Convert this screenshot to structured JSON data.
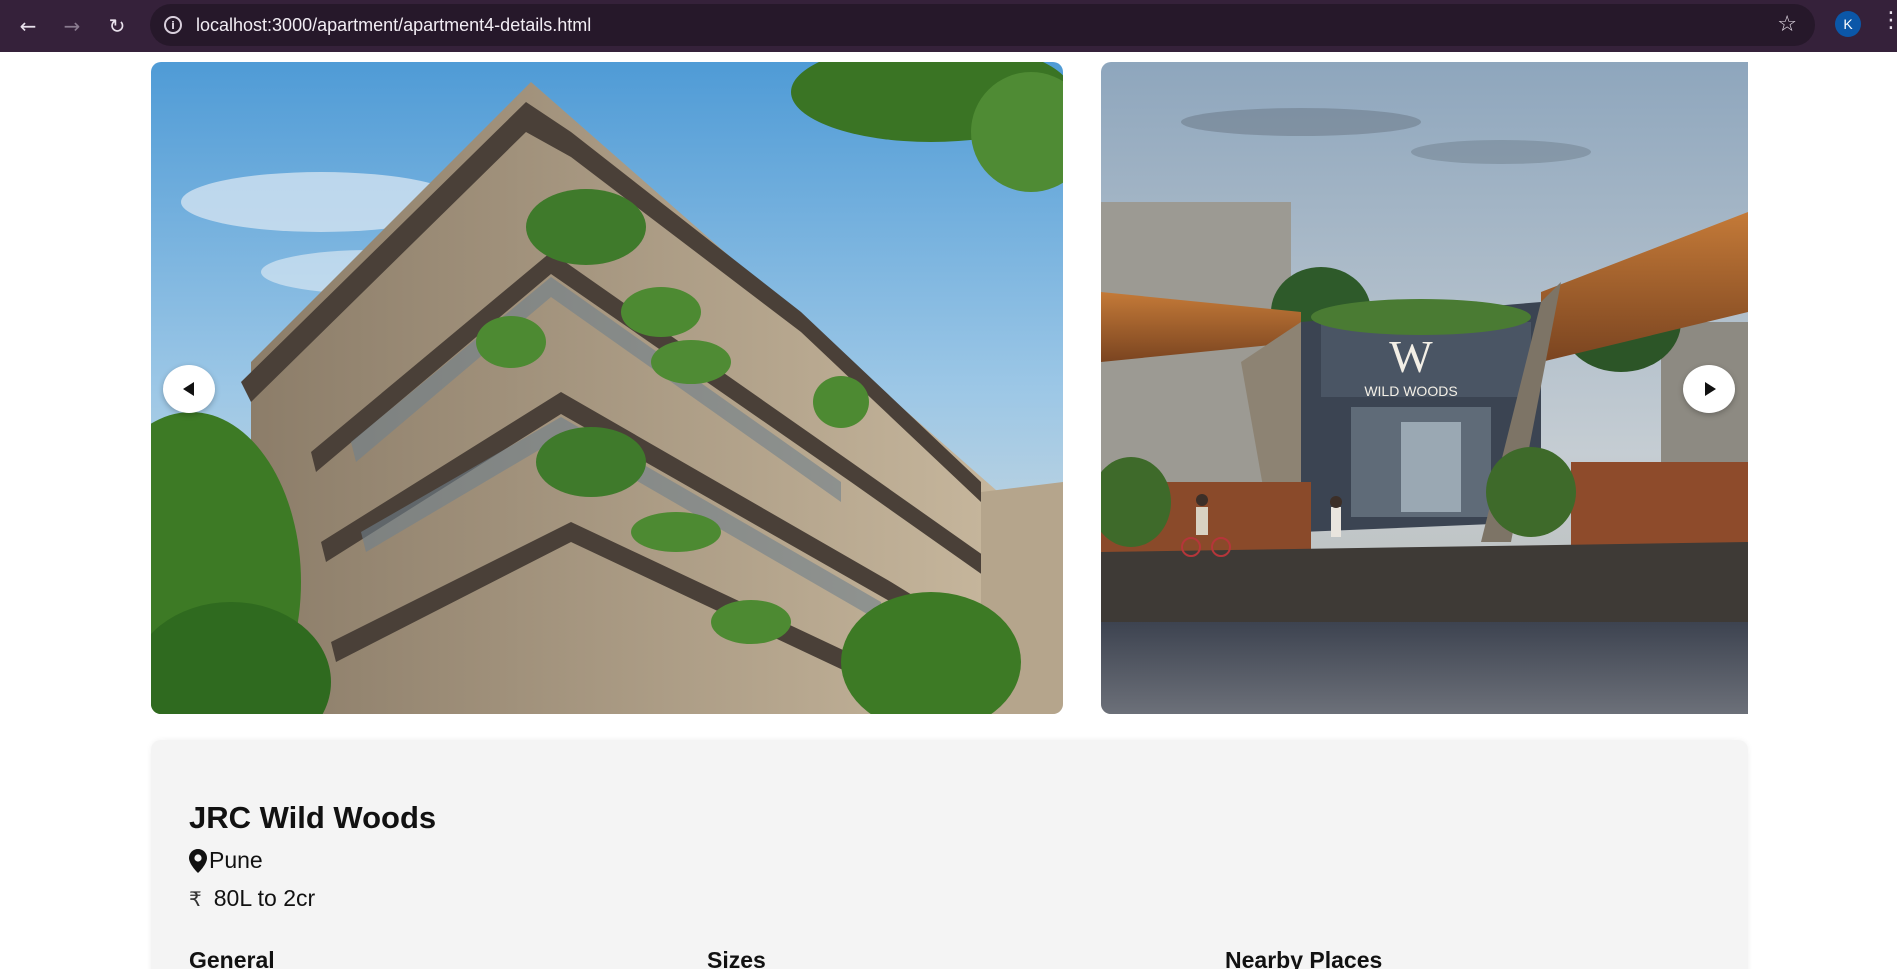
{
  "browser": {
    "url": "localhost:3000/apartment/apartment4-details.html",
    "profile_initial": "K",
    "icons": {
      "back": "back-arrow-icon",
      "forward": "forward-arrow-icon",
      "reload": "reload-icon",
      "info": "site-info-icon",
      "star": "bookmark-star-icon",
      "menu": "kebab-menu-icon"
    },
    "chrome_color": "#35213a"
  },
  "carousel": {
    "slides": [
      {
        "name": "building-facade-image",
        "sign_text": ""
      },
      {
        "name": "wild-woods-entrance-image",
        "sign_letter": "W",
        "sign_text": "WILD WOODS"
      }
    ]
  },
  "property": {
    "title": "JRC Wild Woods",
    "location": "Pune",
    "price_symbol": "₹",
    "price": "80L to 2cr",
    "sections": {
      "general": "General",
      "sizes": "Sizes",
      "nearby": "Nearby Places"
    }
  }
}
